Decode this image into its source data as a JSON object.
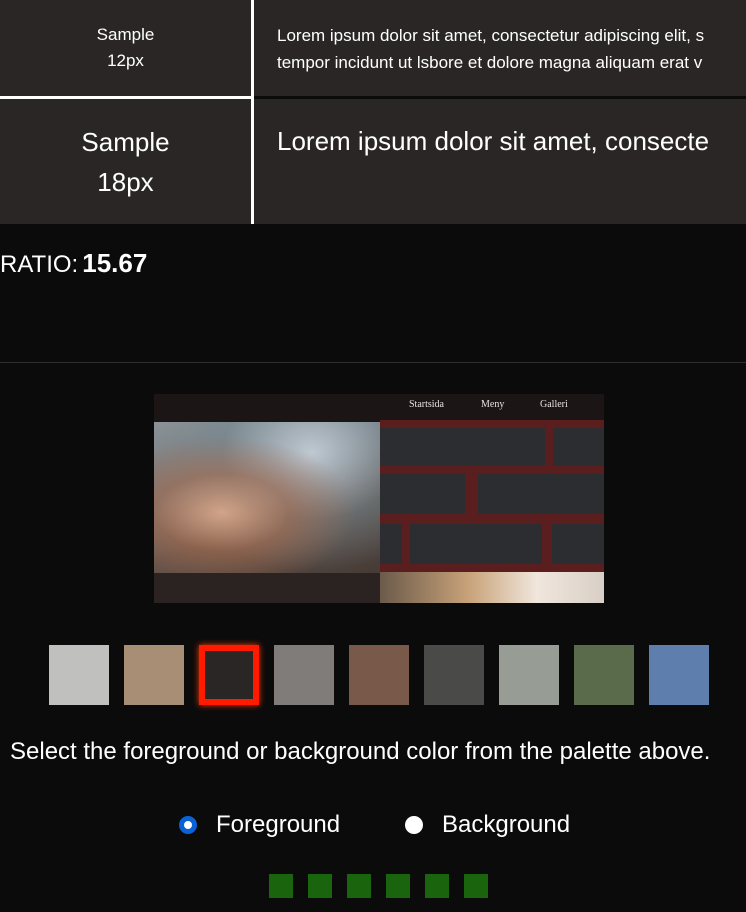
{
  "samples": [
    {
      "label_line1": "Sample",
      "label_line2": "12px",
      "text": "Lorem ipsum dolor sit amet, consectetur adipiscing elit, s",
      "text_line2": "tempor incidunt ut lsbore et dolore magna aliquam erat v"
    },
    {
      "label_line1": "Sample",
      "label_line2": "18px",
      "text": "Lorem ipsum dolor sit amet, consecte"
    }
  ],
  "ratio": {
    "label": "RATIO:",
    "value": "15.67"
  },
  "preview": {
    "nav": [
      "Startsida",
      "Meny",
      "Galleri"
    ]
  },
  "palette": {
    "colors": [
      "#c0c0bf",
      "#a88e75",
      "#2a2626",
      "#807c79",
      "#795949",
      "#4a4b49",
      "#979c94",
      "#5a6b4c",
      "#5e7fae"
    ],
    "selected_index": 2,
    "selected_border_color": "#ff1a00"
  },
  "instructions": "Select the foreground or background color from the palette above.",
  "options": [
    {
      "label": "Foreground",
      "checked": true
    },
    {
      "label": "Background",
      "checked": false
    }
  ],
  "indicators": {
    "count": 6,
    "color": "#1a640d"
  }
}
